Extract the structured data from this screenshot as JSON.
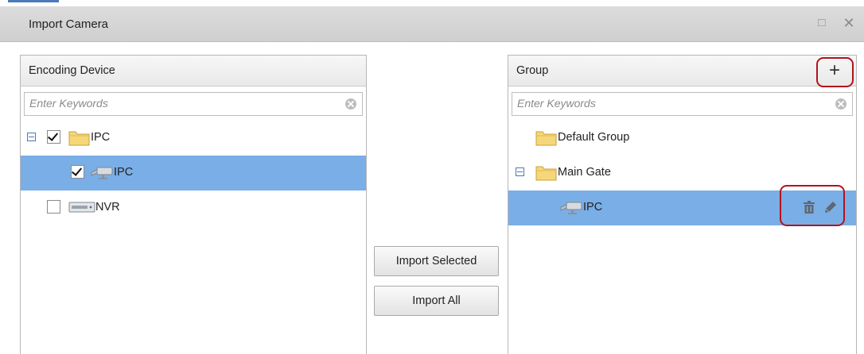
{
  "window": {
    "title": "Import Camera",
    "maximize_glyph": "□",
    "close_glyph": "✕"
  },
  "left_panel": {
    "title": "Encoding Device",
    "search": {
      "placeholder": "Enter Keywords",
      "value": ""
    },
    "tree": [
      {
        "label": "IPC",
        "type": "folder",
        "expanded": true,
        "checked": true,
        "icon": "folder-icon"
      },
      {
        "label": "IPC",
        "type": "camera",
        "checked": true,
        "selected": true,
        "icon": "camera-icon"
      },
      {
        "label": "NVR",
        "type": "nvr",
        "checked": false,
        "icon": "nvr-icon"
      }
    ]
  },
  "buttons": {
    "import_selected": "Import Selected",
    "import_all": "Import All"
  },
  "right_panel": {
    "title": "Group",
    "add_glyph": "+",
    "search": {
      "placeholder": "Enter Keywords",
      "value": ""
    },
    "tree": [
      {
        "label": "Default Group",
        "type": "folder",
        "icon": "folder-icon"
      },
      {
        "label": "Main Gate",
        "type": "folder",
        "expanded": true,
        "icon": "folder-icon"
      },
      {
        "label": "IPC",
        "type": "camera",
        "selected": true,
        "icon": "camera-icon",
        "actions": [
          "delete-icon",
          "edit-icon"
        ]
      }
    ]
  },
  "colors": {
    "selection": "#7aaee6",
    "highlight": "#b3131a",
    "folder": "#f5d77a"
  }
}
